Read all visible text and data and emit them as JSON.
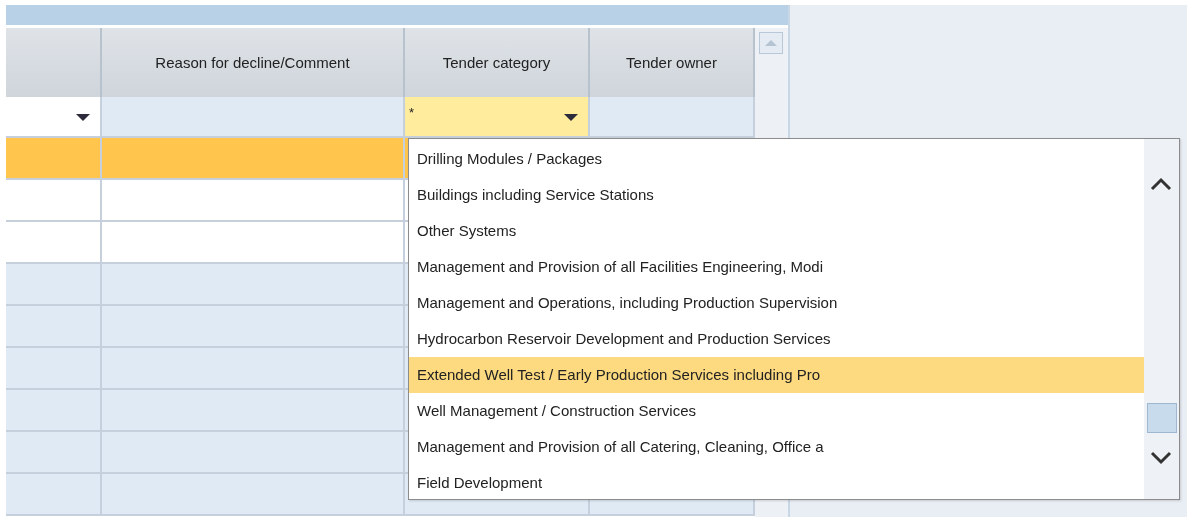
{
  "table": {
    "columns": [
      {},
      {
        "label": "Reason for decline/Comment"
      },
      {
        "label": "Tender category"
      },
      {
        "label": "Tender owner"
      }
    ],
    "filters": [
      {
        "kind": "dropdown",
        "active": false
      },
      {
        "kind": "text",
        "active": false
      },
      {
        "kind": "dropdown",
        "value": "*",
        "active": true
      },
      {
        "kind": "text",
        "active": false
      }
    ],
    "rows": [
      {
        "selected": true,
        "editable": true
      },
      {
        "selected": false,
        "editable": true
      },
      {
        "selected": false,
        "editable": true
      },
      {
        "selected": false,
        "editable": false
      },
      {
        "selected": false,
        "editable": false
      },
      {
        "selected": false,
        "editable": false
      },
      {
        "selected": false,
        "editable": false
      },
      {
        "selected": false,
        "editable": false
      },
      {
        "selected": false,
        "editable": false
      }
    ]
  },
  "dropdown": {
    "items": [
      {
        "label": "Drilling Modules / Packages",
        "selected": false
      },
      {
        "label": "Buildings including Service Stations",
        "selected": false
      },
      {
        "label": "Other Systems",
        "selected": false
      },
      {
        "label": "Management and Provision of all Facilities Engineering, Modi",
        "selected": false
      },
      {
        "label": "Management and Operations, including Production Supervision",
        "selected": false
      },
      {
        "label": "Hydrocarbon Reservoir Development and Production Services",
        "selected": false
      },
      {
        "label": "Extended Well Test / Early Production Services including Pro",
        "selected": true
      },
      {
        "label": "Well Management / Construction Services",
        "selected": false
      },
      {
        "label": "Management and Provision of all Catering, Cleaning, Office a",
        "selected": false
      },
      {
        "label": "Field Development",
        "selected": false
      }
    ]
  }
}
